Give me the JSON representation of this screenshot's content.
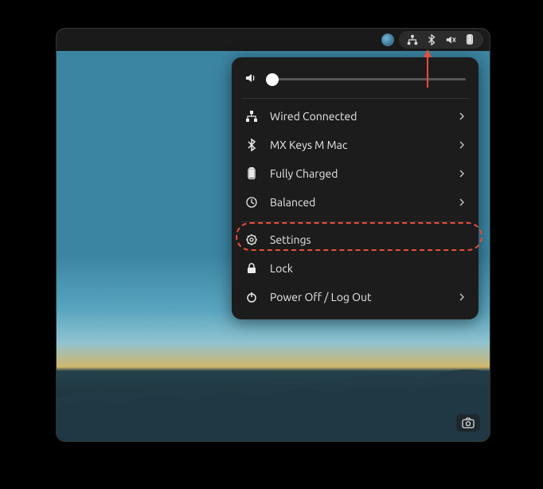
{
  "topbar": {
    "icons": [
      "network-wired-icon",
      "bluetooth-icon",
      "volume-muted-icon",
      "battery-full-icon"
    ]
  },
  "menu": {
    "volume_percent": 5,
    "items": [
      {
        "icon": "network-wired-icon",
        "label": "Wired Connected",
        "has_submenu": true
      },
      {
        "icon": "bluetooth-icon",
        "label": "MX Keys M Mac",
        "has_submenu": true
      },
      {
        "icon": "battery-icon",
        "label": "Fully Charged",
        "has_submenu": true
      },
      {
        "icon": "power-mode-icon",
        "label": "Balanced",
        "has_submenu": true
      }
    ],
    "footer": [
      {
        "icon": "settings-icon",
        "label": "Settings",
        "has_submenu": false
      },
      {
        "icon": "lock-icon",
        "label": "Lock",
        "has_submenu": false
      },
      {
        "icon": "power-icon",
        "label": "Power Off / Log Out",
        "has_submenu": true
      }
    ]
  },
  "annotations": {
    "highlight_target": "settings-menu-item",
    "arrow_points_to": "bluetooth-tray-icon",
    "arrow_color": "#e74c3c"
  }
}
